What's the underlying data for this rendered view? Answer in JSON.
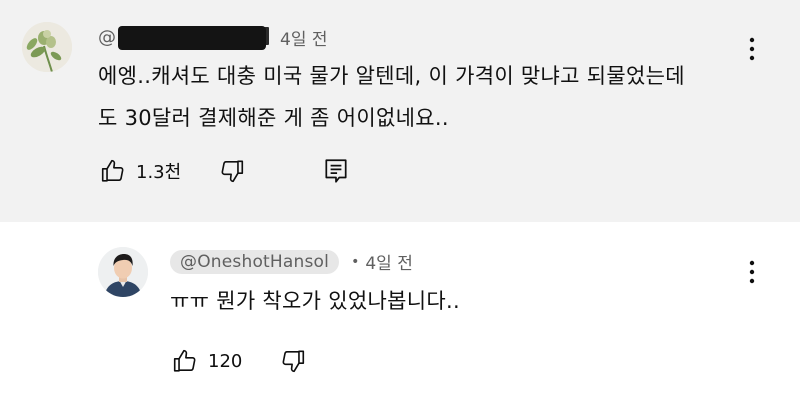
{
  "thread": {
    "comment": {
      "time": "4일 전",
      "handle_prefix": "@",
      "text_line1": "에엥..캐셔도 대충 미국 물가 알텐데, 이 가격이 맞냐고 되물었는데",
      "text_line2": "도 30달러 결제해준 게 좀 어이없네요..",
      "likes": "1.3천"
    },
    "reply": {
      "handle": "@OneshotHansol",
      "separator": "•",
      "time": "4일 전",
      "text": "ㅠㅠ 뭔가 착오가 있었나봅니다..",
      "likes": "120"
    }
  },
  "icons": {
    "like": "thumbs-up-icon",
    "dislike": "thumbs-down-icon",
    "reply": "reply-comment-icon",
    "more": "more-vertical-icon"
  },
  "colors": {
    "top_bg": "#f2f2f2",
    "reply_bg": "#ffffff",
    "meta_text": "#606060"
  }
}
